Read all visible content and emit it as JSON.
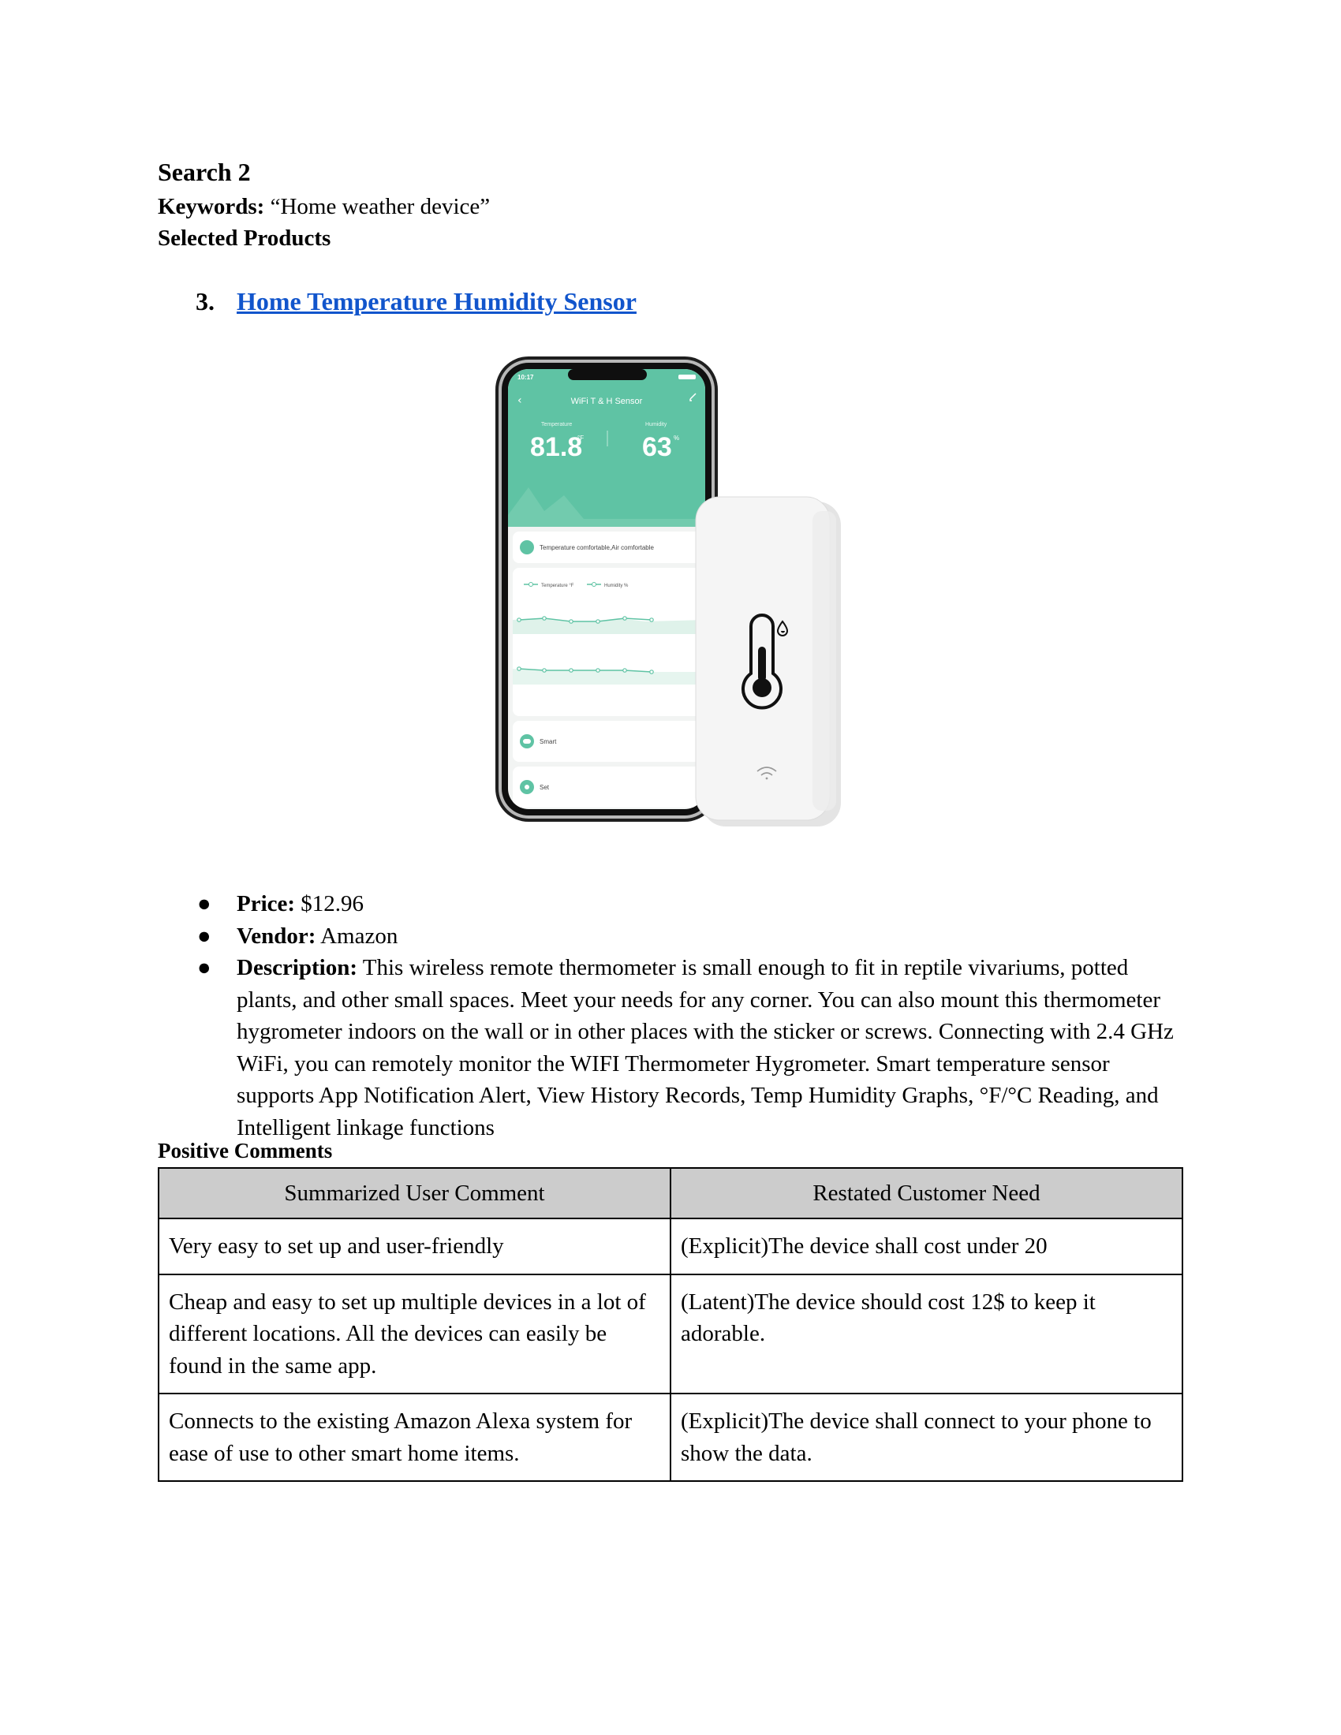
{
  "heading": "Search 2",
  "keywords": {
    "label": "Keywords:",
    "value": "“Home weather device”"
  },
  "selected_products_label": "Selected Products",
  "product": {
    "number": "3.",
    "link_text": "Home Temperature Humidity Sensor"
  },
  "image": {
    "phone": {
      "status_time": "10:17",
      "app_title": "WiFi T & H Sensor",
      "temp_label": "Temperature",
      "temp_value": "81.8",
      "temp_unit": "°F",
      "hum_label": "Humidity",
      "hum_value": "63",
      "hum_unit": "%",
      "comfort_text": "Temperature comfortable,Air comfortable",
      "legend_temp": "Temperature °F",
      "legend_hum": "Humidity %",
      "smart_label": "Smart",
      "set_label": "Set"
    },
    "colors": {
      "app_green": "#5fc3a4",
      "card_bg": "#ffffff",
      "device_white": "#f3f3f3"
    }
  },
  "details": {
    "price_label": "Price:",
    "price_value": "$12.96",
    "vendor_label": "Vendor:",
    "vendor_value": "Amazon",
    "description_label": "Description:",
    "description_value": "This wireless remote thermometer is small enough to fit in reptile vivariums, potted plants, and other small spaces. Meet your needs for any corner. You can also mount this thermometer hygrometer indoors on the wall or in other places with the sticker or screws. Connecting with 2.4 GHz WiFi, you can remotely monitor the WIFI Thermometer Hygrometer. Smart temperature sensor supports App Notification Alert, View History Records, Temp Humidity Graphs, °F/°C Reading, and Intelligent linkage functions"
  },
  "positive_comments_label": "Positive Comments",
  "table": {
    "headers": [
      "Summarized User Comment",
      "Restated Customer Need"
    ],
    "rows": [
      [
        "Very easy to set up and user-friendly",
        "(Explicit)The device shall cost under 20"
      ],
      [
        "Cheap and easy to set up multiple devices in a lot of different locations. All the devices can easily be found in the same app.",
        "(Latent)The device should cost 12$ to keep it adorable."
      ],
      [
        "Connects to the existing Amazon Alexa system for ease of use to other smart home items.",
        "(Explicit)The device shall connect to your phone to show the data."
      ]
    ]
  }
}
